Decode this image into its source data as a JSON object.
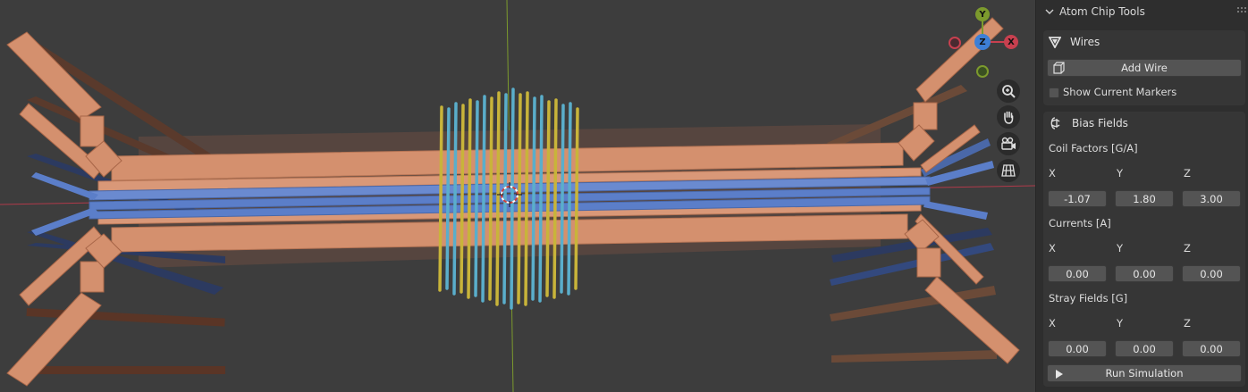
{
  "viewport": {
    "gizmo_axes": {
      "x": "X",
      "y": "Y",
      "z": "Z"
    },
    "tools": [
      "zoom-icon",
      "pan-hand-icon",
      "camera-icon",
      "grid-ortho-icon"
    ],
    "colors": {
      "background": "#3d3d3d",
      "copper_wire": "#d4906e",
      "blue_wire": "#5b7ec9",
      "yellow_coil": "#c8b43a",
      "cyan_coil": "#5aaecb",
      "y_axis_line": "#7c9a2d",
      "x_axis_line": "#b03a4a"
    }
  },
  "sidebar": {
    "panel_title": "Atom Chip Tools",
    "wires": {
      "header": "Wires",
      "add_wire_label": "Add Wire",
      "show_markers_label": "Show Current Markers",
      "show_markers_checked": false
    },
    "bias_fields": {
      "header": "Bias Fields",
      "coil_factors": {
        "label": "Coil Factors [G/A]",
        "x_label": "X",
        "y_label": "Y",
        "z_label": "Z",
        "x": "-1.07",
        "y": "1.80",
        "z": "3.00"
      },
      "currents": {
        "label": "Currents [A]",
        "x_label": "X",
        "y_label": "Y",
        "z_label": "Z",
        "x": "0.00",
        "y": "0.00",
        "z": "0.00"
      },
      "stray_fields": {
        "label": "Stray Fields [G]",
        "x_label": "X",
        "y_label": "Y",
        "z_label": "Z",
        "x": "0.00",
        "y": "0.00",
        "z": "0.00"
      },
      "run_label": "Run Simulation"
    }
  }
}
